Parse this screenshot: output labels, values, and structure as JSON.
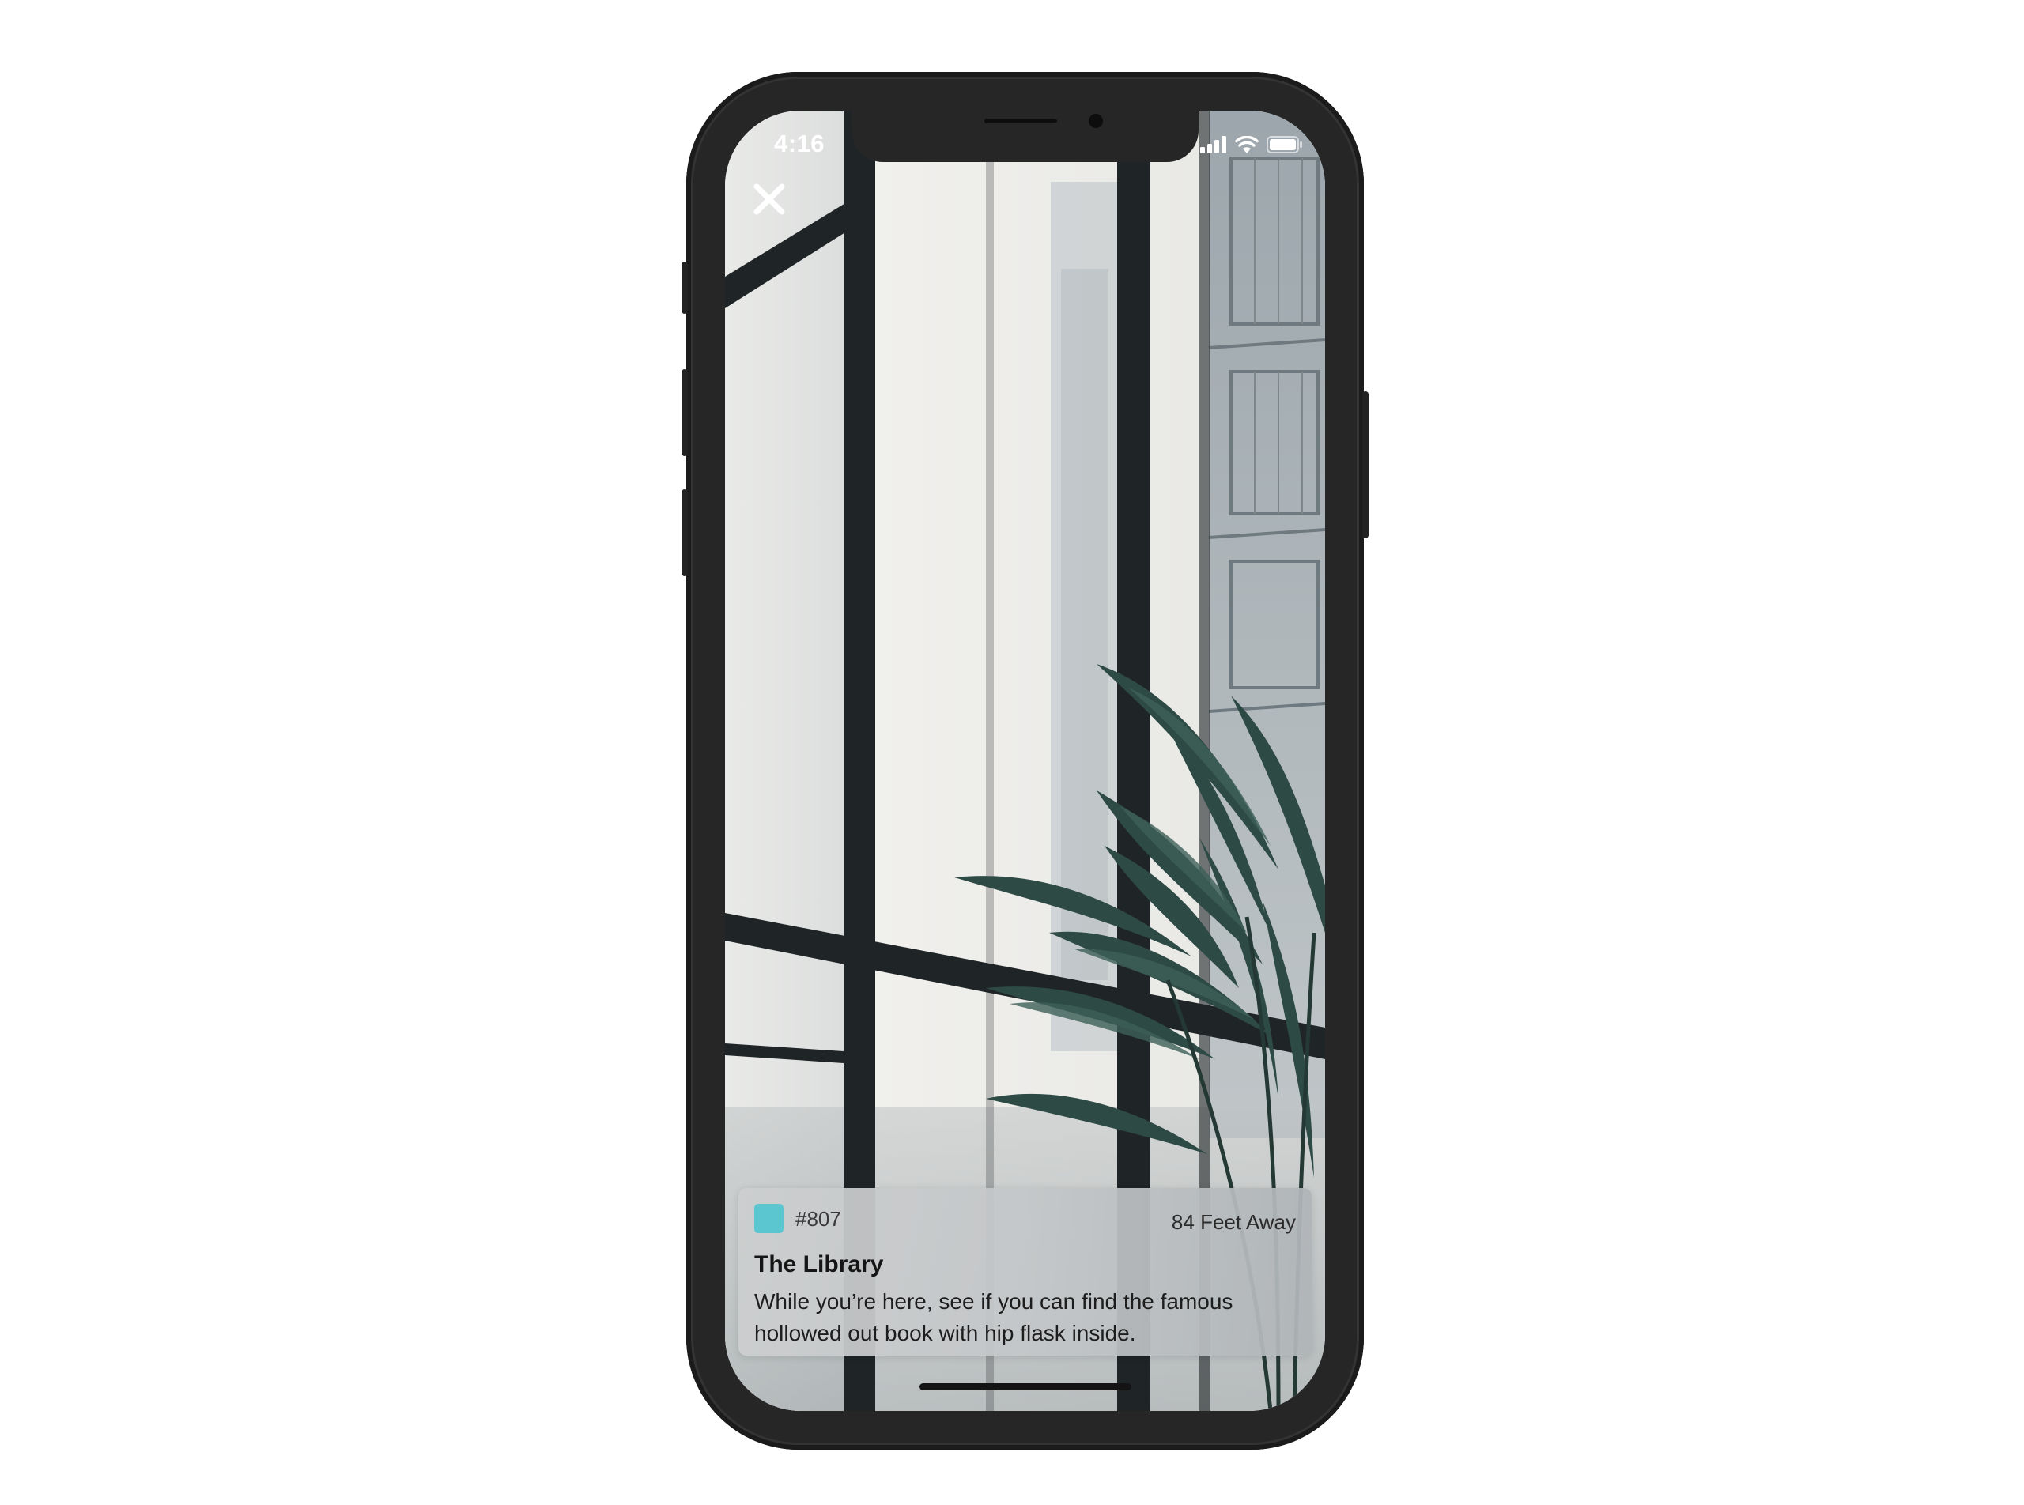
{
  "status_bar": {
    "time": "4:16",
    "signal_icon": "cellular-signal-icon",
    "wifi_icon": "wifi-icon",
    "battery_icon": "battery-icon"
  },
  "header": {
    "close_icon": "close-icon"
  },
  "location_card": {
    "number": "#807",
    "distance": "84 Feet Away",
    "title": "The Library",
    "description": "While you’re here, see if you can find the famous hollowed out book with hip flask inside.",
    "swatch_color": "#5cc6d0"
  },
  "colors": {
    "status_text": "#ffffff",
    "device_frame": "#262626"
  }
}
